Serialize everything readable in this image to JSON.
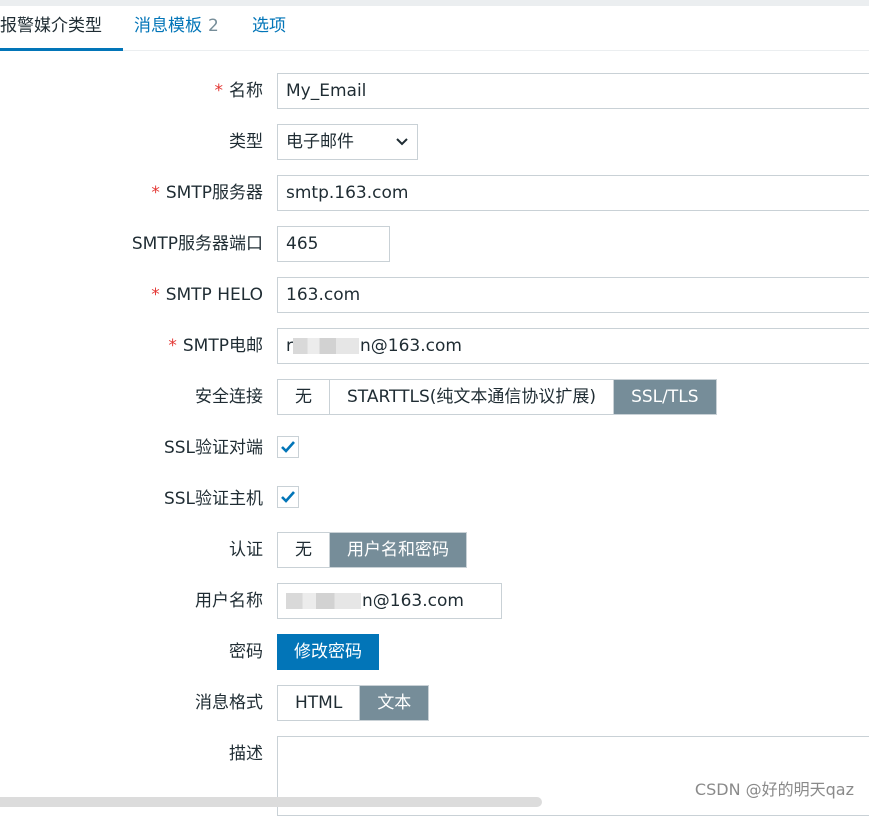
{
  "tabs": [
    {
      "label": "报警媒介类型"
    },
    {
      "label": "消息模板",
      "count": "2"
    },
    {
      "label": "选项"
    }
  ],
  "form": {
    "name": {
      "label": "名称",
      "value": "My_Email"
    },
    "type": {
      "label": "类型",
      "value": "电子邮件"
    },
    "smtp_server": {
      "label": "SMTP服务器",
      "value": "smtp.163.com"
    },
    "smtp_port": {
      "label": "SMTP服务器端口",
      "value": "465"
    },
    "smtp_helo": {
      "label": "SMTP HELO",
      "value": "163.com"
    },
    "smtp_email": {
      "label": "SMTP电邮",
      "prefix": "r",
      "value_suffix": "n@163.com"
    },
    "security": {
      "label": "安全连接",
      "options": [
        "无",
        "STARTTLS(纯文本通信协议扩展)",
        "SSL/TLS"
      ],
      "selected": "SSL/TLS"
    },
    "ssl_verify_peer": {
      "label": "SSL验证对端",
      "checked": true
    },
    "ssl_verify_host": {
      "label": "SSL验证主机",
      "checked": true
    },
    "auth": {
      "label": "认证",
      "options": [
        "无",
        "用户名和密码"
      ],
      "selected": "用户名和密码"
    },
    "username": {
      "label": "用户名称",
      "value_suffix": "n@163.com"
    },
    "password": {
      "label": "密码",
      "button": "修改密码"
    },
    "message_format": {
      "label": "消息格式",
      "options": [
        "HTML",
        "文本"
      ],
      "selected": "文本"
    },
    "description": {
      "label": "描述",
      "value": ""
    }
  },
  "required_mark": "*",
  "watermark": "CSDN @好的明天qaz"
}
